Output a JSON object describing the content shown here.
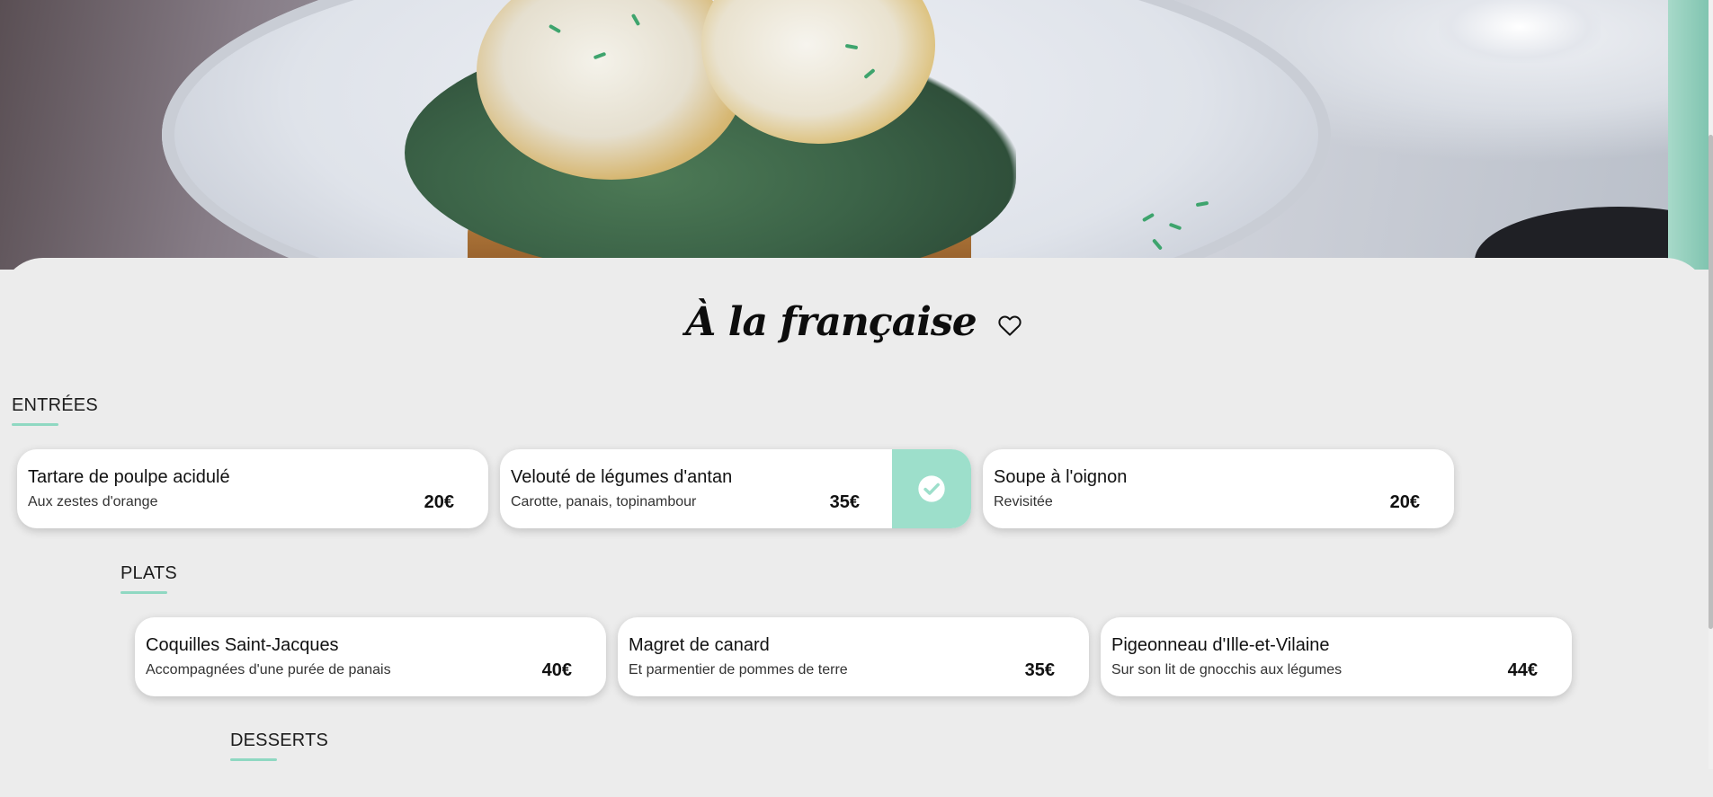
{
  "hero": {
    "image": "eggs-benedict-plate-photo"
  },
  "page": {
    "title": "À la française"
  },
  "colors": {
    "accent": "#8fd8c2",
    "selected": "#9ddfcb",
    "background": "#ececec"
  },
  "sections": [
    {
      "label": "ENTRÉES",
      "items": [
        {
          "name": "Tartare de poulpe acidulé",
          "description": "Aux zestes d'orange",
          "price": "20€",
          "selected": false
        },
        {
          "name": "Velouté de légumes d'antan",
          "description": "Carotte, panais, topinambour",
          "price": "35€",
          "selected": true
        },
        {
          "name": "Soupe à l'oignon",
          "description": "Revisitée",
          "price": "20€",
          "selected": false
        }
      ]
    },
    {
      "label": "PLATS",
      "items": [
        {
          "name": "Coquilles Saint-Jacques",
          "description": "Accompagnées d'une purée de panais",
          "price": "40€",
          "selected": false
        },
        {
          "name": "Magret de canard",
          "description": "Et parmentier de pommes de terre",
          "price": "35€",
          "selected": false
        },
        {
          "name": "Pigeonneau d'Ille-et-Vilaine",
          "description": "Sur son lit de gnocchis aux légumes",
          "price": "44€",
          "selected": false
        }
      ]
    },
    {
      "label": "DESSERTS",
      "items": []
    }
  ],
  "icons": {
    "favorite": "heart-outline-icon",
    "selected": "check-circle-icon"
  }
}
